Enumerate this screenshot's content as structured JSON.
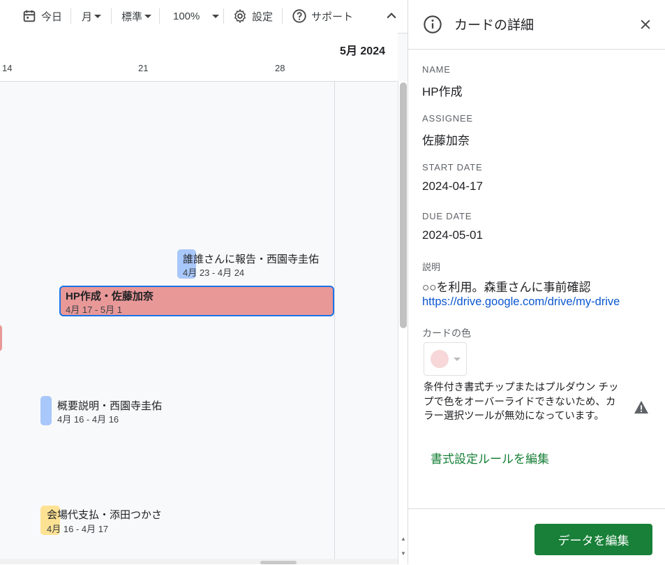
{
  "toolbar": {
    "today_label": "今日",
    "view_label": "月",
    "density_label": "標準",
    "zoom_label": "100%",
    "settings_label": "設定",
    "support_label": "サポート"
  },
  "timeline": {
    "month_label": "5月 2024",
    "day_ticks": [
      "14",
      "21",
      "28"
    ]
  },
  "cards": [
    {
      "title": "誰誰さんに報告・西園寺圭佑",
      "dates": "4月 23 - 4月 24",
      "color": "#a8c7fa"
    },
    {
      "title": "HP作成・佐藤加奈",
      "dates": "4月 17 - 5月 1",
      "color": "#e99898",
      "selected": true
    },
    {
      "title": "概要説明・西園寺圭佑",
      "dates": "4月 16 - 4月 16",
      "color": "#a8c7fa"
    },
    {
      "title": "会場代支払・添田つかさ",
      "dates": "4月 16 - 4月 17",
      "color": "#fde293"
    }
  ],
  "panel": {
    "title": "カードの詳細",
    "fields": {
      "name_label": "NAME",
      "name_value": "HP作成",
      "assignee_label": "ASSIGNEE",
      "assignee_value": "佐藤加奈",
      "start_label": "START DATE",
      "start_value": "2024-04-17",
      "due_label": "DUE DATE",
      "due_value": "2024-05-01",
      "desc_label": "説明",
      "desc_text": "○○を利用。森重さんに事前確認",
      "desc_link": "https://drive.google.com/drive/my-drive"
    },
    "color_label": "カードの色",
    "color_swatch": "#f7d7d8",
    "warning_text": "条件付き書式チップまたはプルダウン チップで色をオーバーライドできないため、カラー選択ツールが無効になっています。",
    "rule_link": "書式設定ルールを編集",
    "edit_button": "データを編集"
  },
  "colors": {
    "accent_green": "#188038",
    "link_blue": "#0b57d0",
    "selected_border": "#1a73e8"
  }
}
